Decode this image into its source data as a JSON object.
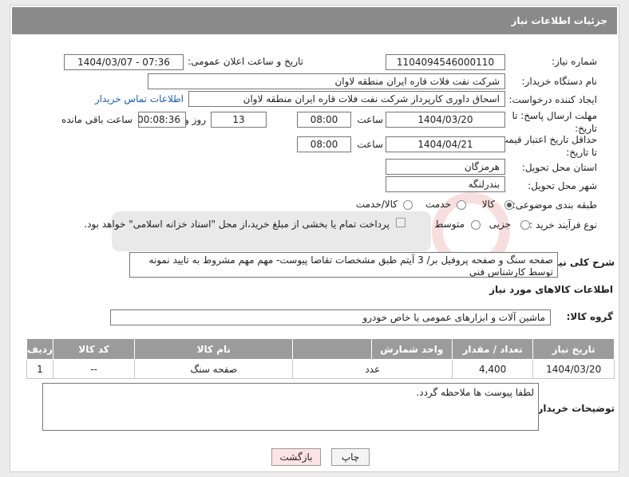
{
  "header": {
    "title": "جزئیات اطلاعات نیاز"
  },
  "fields": {
    "need_number_label": "شماره نیاز:",
    "need_number": "1104094546000110",
    "announce_label": "تاریخ و ساعت اعلان عمومی:",
    "announce_value": "1404/03/07 - 07:36",
    "buyer_org_label": "نام دستگاه خریدار:",
    "buyer_org": "شرکت نفت فلات قاره ایران منطقه لاوان",
    "creator_label": "ایجاد کننده درخواست:",
    "creator": "اسحاق داوری کارپرداز شرکت نفت فلات قاره ایران منطقه لاوان",
    "contact_link": "اطلاعات تماس خریدار",
    "reply_deadline_label": "مهلت ارسال پاسخ: تا تاریخ:",
    "reply_date": "1404/03/20",
    "reply_time_label": "ساعت",
    "reply_time": "08:00",
    "days_value": "13",
    "days_label": "روز و",
    "remaining_time": "00:08:36",
    "remaining_label": "ساعت باقی مانده",
    "price_deadline_label": "حداقل تاریخ اعتبار قیمت: تا تاریخ:",
    "price_date": "1404/04/21",
    "price_time_label": "ساعت",
    "price_time": "08:00",
    "province_label": "استان محل تحویل:",
    "province": "هرمزگان",
    "city_label": "شهر محل تحویل:",
    "city": "بندرلنگه",
    "category_label": "طبقه بندی موضوعی:",
    "category_options": [
      "کالا",
      "خدمت",
      "کالا/خدمت"
    ],
    "process_label": "نوع فرآیند خرید :",
    "process_options": [
      "جزیی",
      "متوسط"
    ],
    "payment_note": "پرداخت تمام یا بخشی از مبلغ خرید،از محل \"اسناد خزانه اسلامی\" خواهد بود.",
    "desc_label": "شرح کلی نیاز:",
    "desc_value": "صفحه سنگ و صفحه پروفیل بر/ 3 آیتم طبق مشخصات تقاضا پیوست- مهم مهم مشروط به تایید نمونه توسط کارشناس فنی"
  },
  "goods": {
    "section_title": "اطلاعات کالاهای مورد نیاز",
    "group_label": "گروه کالا:",
    "group_value": "ماشین آلات و ابزارهای عمومی یا خاص خودرو",
    "columns": [
      "ردیف",
      "کد کالا",
      "نام کالا",
      "واحد شمارش",
      "تعداد / مقدار",
      "تاریخ نیاز"
    ],
    "rows": [
      [
        "1",
        "--",
        "صفحه سنگ",
        "عدد",
        "4,400",
        "1404/03/20"
      ]
    ]
  },
  "buyer_notes": {
    "label": "توضیحات خریدار:",
    "value": "لطفا پیوست ها ملاحظه گردد."
  },
  "buttons": {
    "print": "چاپ",
    "back": "بازگشت"
  },
  "colors": {
    "header_bg": "#8a8a8a",
    "link": "#1a5fb4",
    "back_button_bg": "#fde3e3"
  }
}
